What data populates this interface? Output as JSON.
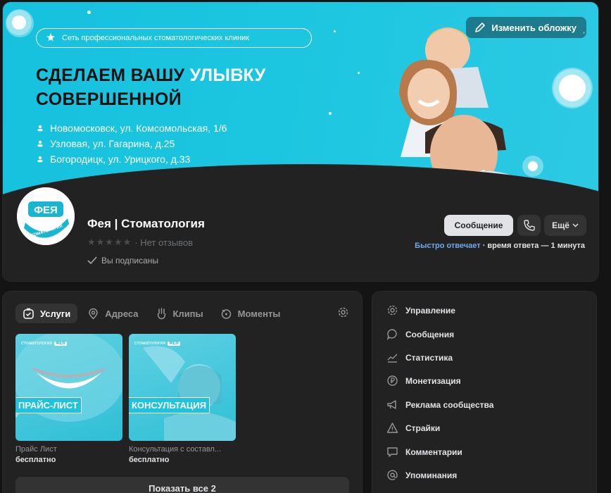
{
  "cover": {
    "tagline": "Сеть профессиональных стоматологических клиник",
    "headline_line1_dark": "СДЕЛАЕМ ВАШУ ",
    "headline_line1_light": "УЛЫБКУ",
    "headline_line2": "СОВЕРШЕННОЙ",
    "addresses": [
      "Новомосковск, ул. Комсомольская, 1/6",
      "Узловая, ул. Гагарина, д.25",
      "Богородицк, ул. Урицкого, д.33"
    ],
    "change_cover_label": "Изменить обложку"
  },
  "profile": {
    "avatar_text_top": "ФЕЯ",
    "avatar_text_bottom": "СТОМАТОЛОГИЯ",
    "name": "Фея | Стоматология",
    "rating_stars": "★★★★★",
    "reviews_text": "· Нет отзывов",
    "subscribed_text": "Вы подписаны",
    "message_button": "Сообщение",
    "more_button": "Ещё",
    "fast_reply_label": "Быстро отвечает",
    "fast_reply_rest": " · время ответа — 1 минута"
  },
  "services": {
    "tabs": [
      {
        "label": "Услуги",
        "icon": "services-icon"
      },
      {
        "label": "Адреса",
        "icon": "location-icon"
      },
      {
        "label": "Клипы",
        "icon": "clips-icon"
      },
      {
        "label": "Моменты",
        "icon": "moments-icon"
      }
    ],
    "items": [
      {
        "banner": "ПРАЙС-ЛИСТ",
        "brand": "стоматология",
        "brand_badge": "ФЕЯ",
        "title": "Прайс Лист",
        "price": "бесплатно"
      },
      {
        "banner": "КОНСУЛЬТАЦИЯ",
        "brand": "стоматология",
        "brand_badge": "ФЕЯ",
        "title": "Консультация с составл...",
        "price": "бесплатно"
      }
    ],
    "show_all_label": "Показать все 2"
  },
  "menu": {
    "items": [
      {
        "label": "Управление",
        "icon": "gear-icon"
      },
      {
        "label": "Сообщения",
        "icon": "message-icon"
      },
      {
        "label": "Статистика",
        "icon": "stats-icon"
      },
      {
        "label": "Монетизация",
        "icon": "ruble-icon"
      },
      {
        "label": "Реклама сообщества",
        "icon": "megaphone-icon"
      },
      {
        "label": "Страйки",
        "icon": "warning-icon"
      },
      {
        "label": "Комментарии",
        "icon": "comment-icon"
      },
      {
        "label": "Упоминания",
        "icon": "at-icon"
      }
    ]
  },
  "colors": {
    "cover_cyan": "#1cc6e0",
    "link_blue": "#71aaeb",
    "card_bg": "#222222",
    "page_bg": "#141414"
  }
}
